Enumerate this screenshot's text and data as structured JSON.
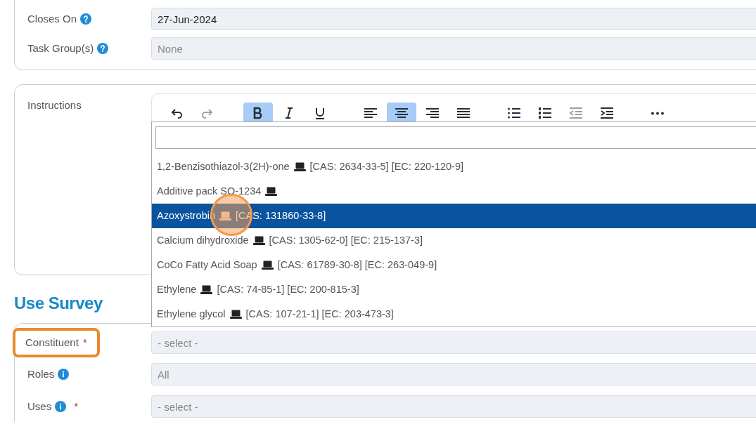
{
  "top_card": {
    "fields": [
      {
        "label": "Closes On",
        "help_icon": true,
        "info_icon": false,
        "value": "27-Jun-2024"
      },
      {
        "label": "Task Group(s)",
        "help_icon": true,
        "info_icon": false,
        "placeholder": "None"
      }
    ]
  },
  "instructions": {
    "label": "Instructions",
    "toolbar_groups": [
      {
        "buttons": [
          {
            "kind": "undo",
            "active": false,
            "disabled": false
          },
          {
            "kind": "redo",
            "active": false,
            "disabled": true
          }
        ]
      },
      {
        "buttons": [
          {
            "kind": "bold",
            "active": true,
            "disabled": false
          },
          {
            "kind": "italic",
            "active": false,
            "disabled": false
          },
          {
            "kind": "underline",
            "active": false,
            "disabled": false
          }
        ]
      },
      {
        "buttons": [
          {
            "kind": "align-left",
            "active": false,
            "disabled": false
          },
          {
            "kind": "align-center",
            "active": true,
            "disabled": false
          },
          {
            "kind": "align-right",
            "active": false,
            "disabled": false
          },
          {
            "kind": "justify",
            "active": false,
            "disabled": false
          }
        ]
      },
      {
        "buttons": [
          {
            "kind": "bullets",
            "active": false,
            "disabled": false
          },
          {
            "kind": "numbered",
            "active": false,
            "disabled": false
          },
          {
            "kind": "outdent",
            "active": false,
            "disabled": true
          },
          {
            "kind": "indent",
            "active": false,
            "disabled": false
          }
        ]
      },
      {
        "buttons": [
          {
            "kind": "more",
            "active": false,
            "disabled": false
          }
        ]
      }
    ]
  },
  "dropdown": {
    "options": [
      {
        "name": "1,2-Benzisothiazol-3(2H)-one",
        "codes": "[CAS: 2634-33-5] [EC: 220-120-9]",
        "selected": false
      },
      {
        "name": "Additive pack SO-1234",
        "selected": false
      },
      {
        "name": "Azoxystrobin",
        "codes": "[CAS: 131860-33-8]",
        "selected": true
      },
      {
        "name": "Calcium dihydroxide",
        "codes": "[CAS: 1305-62-0] [EC: 215-137-3]",
        "selected": false
      },
      {
        "name": "CoCo Fatty Acid Soap",
        "codes": "[CAS: 61789-30-8] [EC: 263-049-9]",
        "selected": false
      },
      {
        "name": "Ethylene",
        "codes": "[CAS: 74-85-1] [EC: 200-815-3]",
        "selected": false
      },
      {
        "name": "Ethylene glycol",
        "codes": "[CAS: 107-21-1] [EC: 203-473-3]",
        "selected": false
      }
    ]
  },
  "use_survey": {
    "title": "Use Survey",
    "fields": [
      {
        "label": "Constituent",
        "help_icon": false,
        "info_icon": false,
        "required_mark": "*",
        "highlighted": true,
        "placeholder": "- select -"
      },
      {
        "label": "Roles",
        "help_icon": false,
        "info_icon": true,
        "highlighted": false,
        "placeholder": "All"
      },
      {
        "label": "Uses",
        "help_icon": false,
        "info_icon": true,
        "required_mark": "*",
        "highlighted": false,
        "placeholder": "- select -"
      }
    ]
  }
}
